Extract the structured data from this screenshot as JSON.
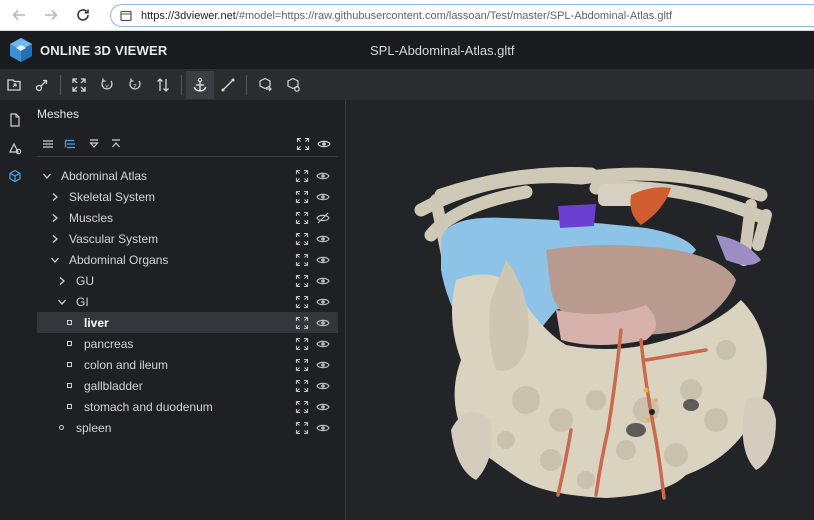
{
  "browser": {
    "url_host": "https://3dviewer.net",
    "url_rest": "/#model=https://raw.githubusercontent.com/lassoan/Test/master/SPL-Abdominal-Atlas.gltf"
  },
  "app": {
    "name": "ONLINE 3D VIEWER",
    "file_title": "SPL-Abdominal-Atlas.gltf"
  },
  "navigator": {
    "title": "Meshes",
    "tree": [
      {
        "label": "Abdominal Atlas",
        "level": 0,
        "type": "group",
        "expanded": true
      },
      {
        "label": "Skeletal System",
        "level": 1,
        "type": "group",
        "expanded": false
      },
      {
        "label": "Muscles",
        "level": 1,
        "type": "group",
        "expanded": false,
        "hidden": true
      },
      {
        "label": "Vascular System",
        "level": 1,
        "type": "group",
        "expanded": false
      },
      {
        "label": "Abdominal Organs",
        "level": 1,
        "type": "group",
        "expanded": true
      },
      {
        "label": "GU",
        "level": 2,
        "type": "group",
        "expanded": false
      },
      {
        "label": "GI",
        "level": 2,
        "type": "group",
        "expanded": true
      },
      {
        "label": "liver",
        "level": 3,
        "type": "mesh",
        "selected": true
      },
      {
        "label": "pancreas",
        "level": 3,
        "type": "mesh"
      },
      {
        "label": "colon and ileum",
        "level": 3,
        "type": "mesh"
      },
      {
        "label": "gallbladder",
        "level": 3,
        "type": "mesh"
      },
      {
        "label": "stomach and duodenum",
        "level": 3,
        "type": "mesh"
      },
      {
        "label": "spleen",
        "level": 2,
        "type": "mesh-round"
      }
    ]
  },
  "colors": {
    "accent": "#4aa3e8",
    "bone": "#d9d3c0",
    "liver_blue": "#8cc3e6",
    "purple": "#6a3fd1",
    "orange": "#d25d2f",
    "teal": "#1fae8c",
    "vessel": "#c96a4e",
    "pink": "#d7b2ad"
  }
}
